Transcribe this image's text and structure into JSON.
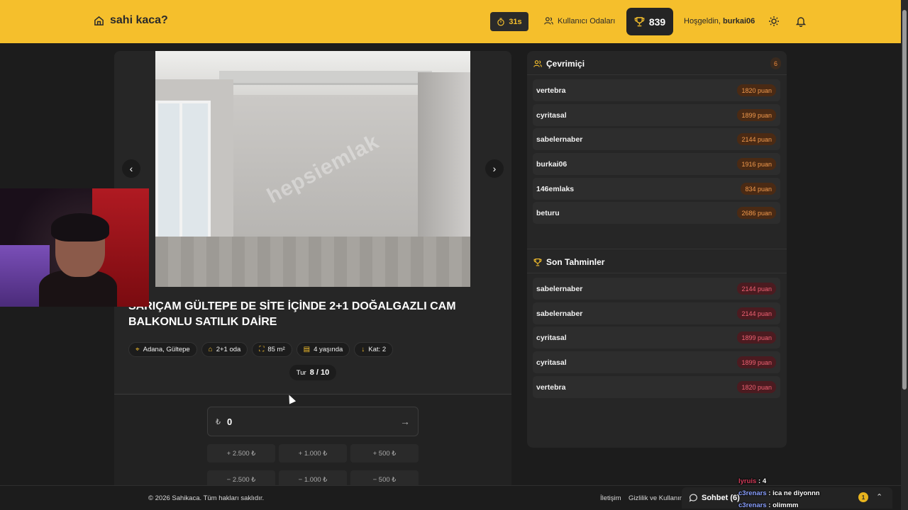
{
  "header": {
    "logo_text": "sahi kaca?",
    "timer": "31s",
    "rooms_label": "Kullanıcı Odaları",
    "score": "839",
    "welcome_prefix": "Hoşgeldin,",
    "username": "burkai06",
    "accent_color": "#f5bf2c"
  },
  "listing": {
    "photo_watermark": "hepsiemlak",
    "title": "SARIÇAM GÜLTEPE DE SİTE İÇİNDE 2+1 DOĞALGAZLI CAM BALKONLU SATILIK DAİRE",
    "tags": [
      {
        "icon": "location-pin-icon",
        "text": "Adana, Gültepe"
      },
      {
        "icon": "home-icon",
        "text": "2+1 oda"
      },
      {
        "icon": "expand-icon",
        "text": "85 m²"
      },
      {
        "icon": "building-icon",
        "text": "4 yaşında"
      },
      {
        "icon": "arrow-down-icon",
        "text": "Kat: 2"
      }
    ],
    "round_label": "Tur",
    "round_value": "8 / 10",
    "currency": "₺",
    "price_value": "0",
    "adjust_buttons": [
      "+ 2.500 ₺",
      "+ 1.000 ₺",
      "+ 500 ₺",
      "− 2.500 ₺",
      "− 1.000 ₺",
      "− 500 ₺"
    ]
  },
  "online": {
    "title": "Çevrimiçi",
    "count": "6",
    "users": [
      {
        "name": "vertebra",
        "points": "1820 puan"
      },
      {
        "name": "cyritasal",
        "points": "1899 puan"
      },
      {
        "name": "sabelernaber",
        "points": "2144 puan"
      },
      {
        "name": "burkai06",
        "points": "1916 puan"
      },
      {
        "name": "146emlaks",
        "points": "834 puan"
      },
      {
        "name": "beturu",
        "points": "2686 puan"
      }
    ]
  },
  "guesses": {
    "title": "Son Tahminler",
    "items": [
      {
        "name": "sabelernaber",
        "points": "2144 puan"
      },
      {
        "name": "sabelernaber",
        "points": "2144 puan"
      },
      {
        "name": "cyritasal",
        "points": "1899 puan"
      },
      {
        "name": "cyritasal",
        "points": "1899 puan"
      },
      {
        "name": "vertebra",
        "points": "1820 puan"
      }
    ]
  },
  "footer": {
    "copyright": "© 2026 Sahikaca. Tüm hakları saklıdır.",
    "link_contact": "İletişim",
    "link_privacy": "Gizlilik ve Kullanım"
  },
  "chat": {
    "label": "Sohbet (6)",
    "notif_count": "1"
  },
  "stream_chat": [
    {
      "user": "lyruis",
      "text": "4"
    },
    {
      "user": "c3renars",
      "text": "ica ne diyonnn"
    },
    {
      "user": "c3renars",
      "text": "olimmm"
    }
  ]
}
